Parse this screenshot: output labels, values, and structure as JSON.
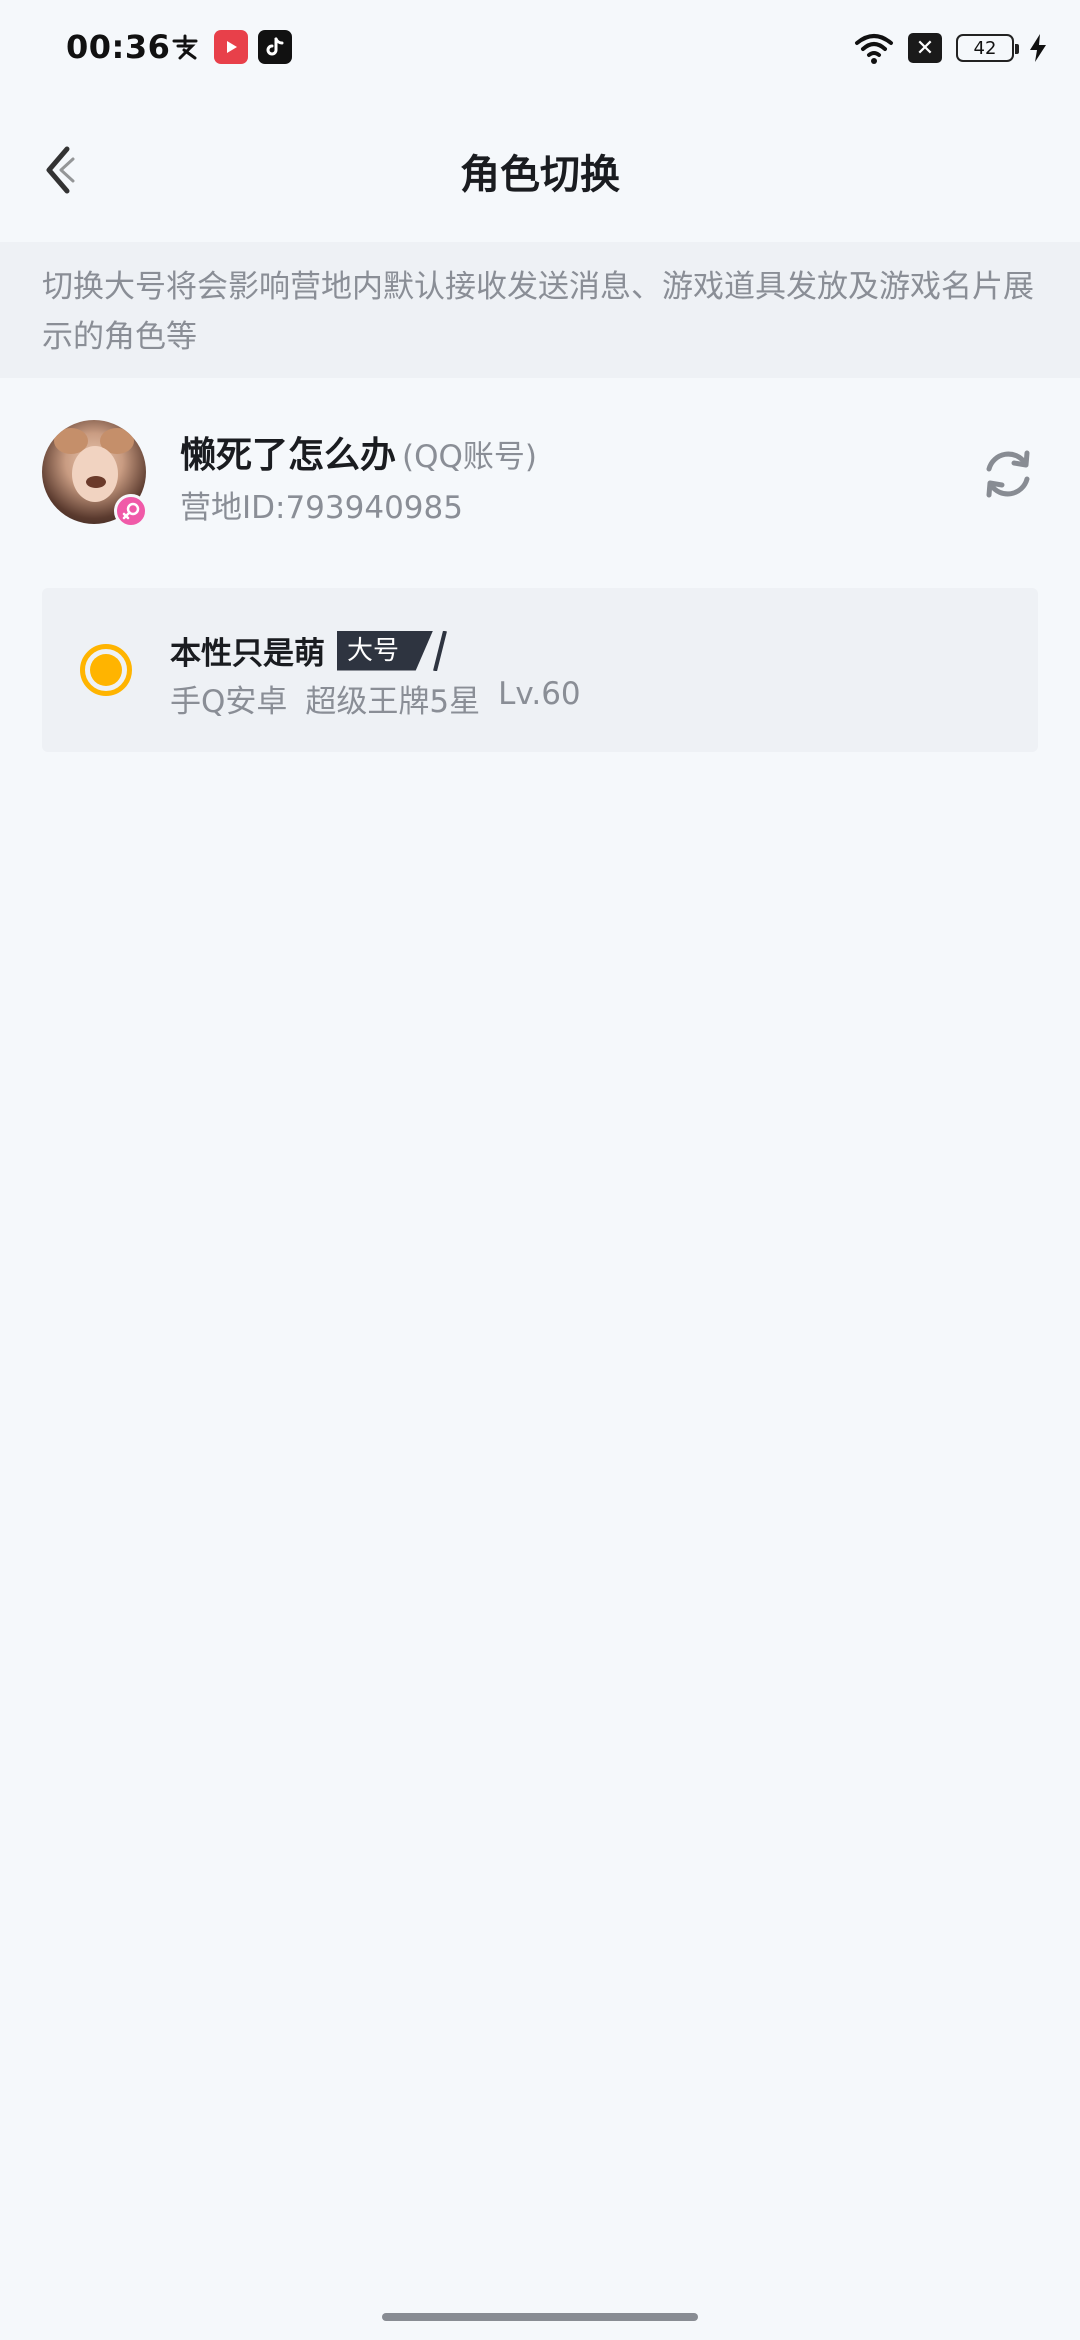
{
  "status_bar": {
    "time": "00:36",
    "battery": "42",
    "notification_icons": [
      "alipay-icon",
      "video-app-icon",
      "tiktok-icon"
    ],
    "system_icons": [
      "wifi-icon",
      "close-box-icon",
      "battery-icon",
      "charging-bolt-icon"
    ]
  },
  "header": {
    "title": "角色切换",
    "back_icon": "chevron-left-icon"
  },
  "notice": {
    "text": "切换大号将会影响营地内默认接收发送消息、游戏道具发放及游戏名片展示的角色等"
  },
  "account": {
    "name": "懒死了怎么办",
    "type": "(QQ账号)",
    "id_text": "营地ID:793940985",
    "gender_icon": "female-icon",
    "switch_icon": "refresh-icon"
  },
  "roles": [
    {
      "name": "本性只是萌",
      "tag": "大号",
      "platform": "手Q安卓",
      "rank": "超级王牌5星",
      "level": "Lv.60",
      "selected": true
    }
  ],
  "colors": {
    "accent": "#ffb400",
    "tag_bg": "#2e3440",
    "gender_badge": "#f05aa8",
    "secondary_text": "#8a8e96"
  }
}
